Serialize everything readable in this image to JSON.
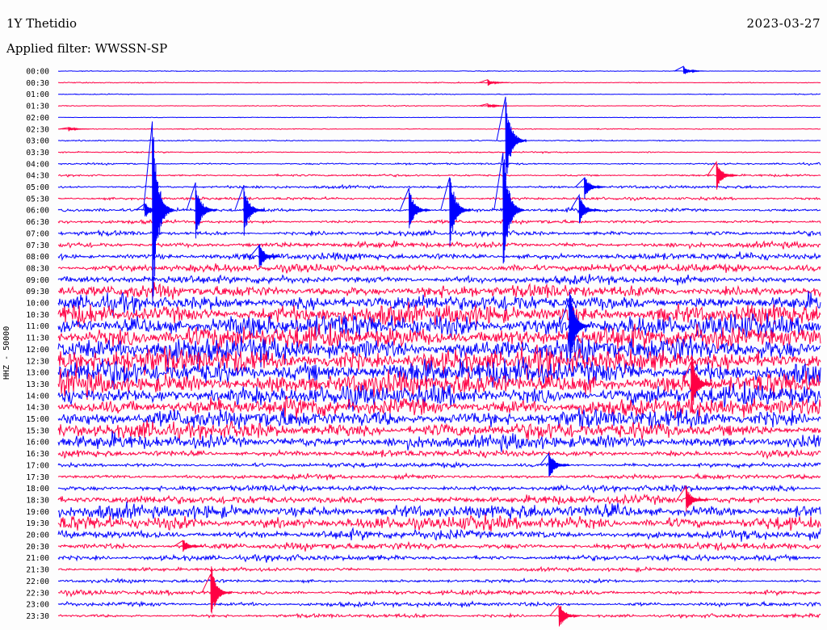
{
  "header": {
    "station": "1Y Thetidio",
    "date": "2023-03-27",
    "filter_label": "Applied filter: WWSSN-SP"
  },
  "channel_label": "HHZ - 50000",
  "colors": {
    "trace_a": "#0000ff",
    "trace_b": "#ff0044",
    "background": "#fdfdfd"
  },
  "chart_data": {
    "type": "line",
    "title": "1Y Thetidio",
    "subtitle": "Applied filter: WWSSN-SP",
    "date": "2023-03-27",
    "ylabel": "HHZ - 50000",
    "xlabel": "",
    "rows_per_hour": 2,
    "row_minutes": 30,
    "row_labels": [
      "00:00",
      "00:30",
      "01:00",
      "01:30",
      "02:00",
      "02:30",
      "03:00",
      "03:30",
      "04:00",
      "04:30",
      "05:00",
      "05:30",
      "06:00",
      "06:30",
      "07:00",
      "07:30",
      "08:00",
      "08:30",
      "09:00",
      "09:30",
      "10:00",
      "10:30",
      "11:00",
      "11:30",
      "12:00",
      "12:30",
      "13:00",
      "13:30",
      "14:00",
      "14:30",
      "15:00",
      "15:30",
      "16:00",
      "16:30",
      "17:00",
      "17:30",
      "18:00",
      "18:30",
      "19:00",
      "19:30",
      "20:00",
      "20:30",
      "21:00",
      "21:30",
      "22:00",
      "22:30",
      "23:00",
      "23:30"
    ],
    "row_colors": [
      "blue",
      "red"
    ],
    "noise_level": [
      0.3,
      0.4,
      0.4,
      0.4,
      0.3,
      0.4,
      0.5,
      0.6,
      0.8,
      0.9,
      1.2,
      1.2,
      1.5,
      1.5,
      2.0,
      2.5,
      3.0,
      3.5,
      3.5,
      5.5,
      7.0,
      9.0,
      10.0,
      10.0,
      11.0,
      11.0,
      11.0,
      10.0,
      9.0,
      8.0,
      8.0,
      7.0,
      6.0,
      3.0,
      2.0,
      2.0,
      2.5,
      3.5,
      6.0,
      6.0,
      4.0,
      3.0,
      2.5,
      1.5,
      1.5,
      2.0,
      2.0,
      1.5
    ],
    "events": [
      {
        "row": 0,
        "minute": 24.7,
        "amplitude": 6
      },
      {
        "row": 1,
        "minute": 17.0,
        "amplitude": 4
      },
      {
        "row": 3,
        "minute": 17.0,
        "amplitude": 3
      },
      {
        "row": 5,
        "minute": 0.5,
        "amplitude": 3
      },
      {
        "row": 6,
        "minute": 17.7,
        "amplitude": 60
      },
      {
        "row": 9,
        "minute": 26.0,
        "amplitude": 20
      },
      {
        "row": 10,
        "minute": 20.8,
        "amplitude": 16
      },
      {
        "row": 12,
        "minute": 3.5,
        "amplitude": 12
      },
      {
        "row": 12,
        "minute": 3.8,
        "amplitude": 140
      },
      {
        "row": 12,
        "minute": 5.5,
        "amplitude": 40
      },
      {
        "row": 12,
        "minute": 7.4,
        "amplitude": 35
      },
      {
        "row": 12,
        "minute": 13.9,
        "amplitude": 30
      },
      {
        "row": 12,
        "minute": 15.5,
        "amplitude": 55
      },
      {
        "row": 12,
        "minute": 17.6,
        "amplitude": 90
      },
      {
        "row": 12,
        "minute": 20.6,
        "amplitude": 22
      },
      {
        "row": 16,
        "minute": 8.0,
        "amplitude": 18
      },
      {
        "row": 22,
        "minute": 20.2,
        "amplitude": 60
      },
      {
        "row": 27,
        "minute": 25.0,
        "amplitude": 45
      },
      {
        "row": 34,
        "minute": 19.4,
        "amplitude": 20
      },
      {
        "row": 37,
        "minute": 24.8,
        "amplitude": 18
      },
      {
        "row": 41,
        "minute": 5.0,
        "amplitude": 10
      },
      {
        "row": 45,
        "minute": 6.1,
        "amplitude": 40
      },
      {
        "row": 47,
        "minute": 19.8,
        "amplitude": 20
      }
    ],
    "grid": false
  }
}
